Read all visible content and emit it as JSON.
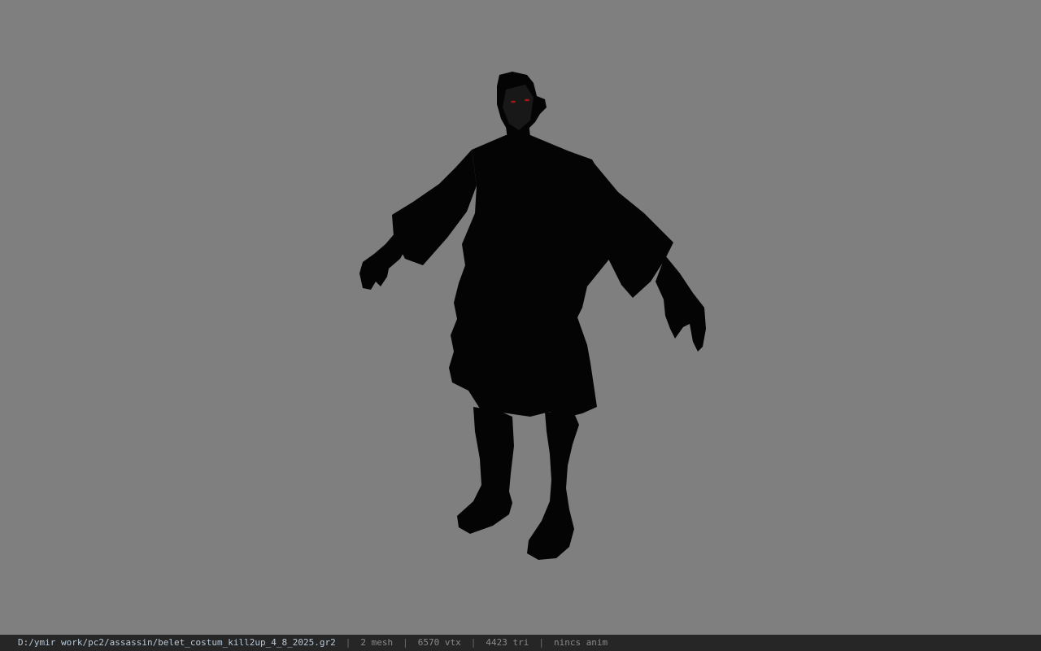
{
  "viewport": {
    "background_color": "#7f7f7f",
    "model": {
      "type": "character-model",
      "silhouette_color": "#000000",
      "eye_color": "#a01818"
    }
  },
  "status_bar": {
    "file_path": "D:/ymir work/pc2/assassin/belet_costum_kill2up_4_8_2025.gr2",
    "separator": "|",
    "mesh_count": "2 mesh",
    "vertex_count": "6570 vtx",
    "triangle_count": "4423 tri",
    "animation": "nincs anim"
  }
}
